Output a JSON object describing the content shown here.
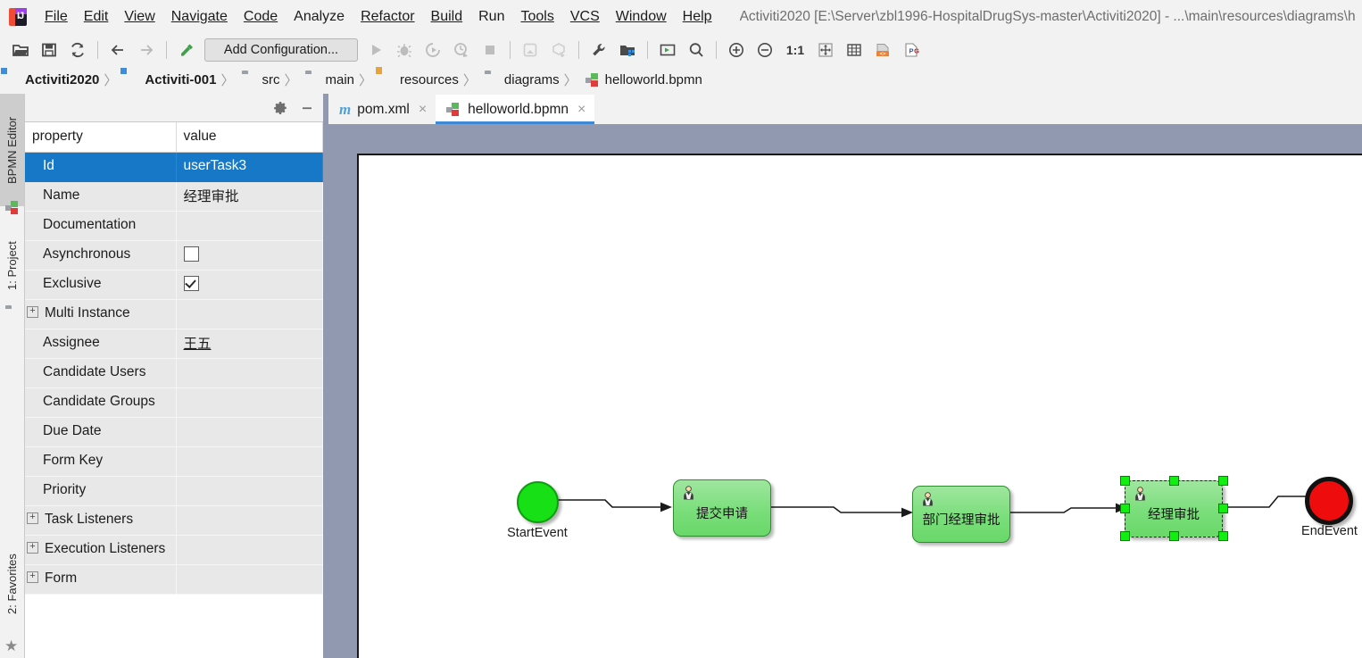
{
  "window": {
    "title": "Activiti2020 [E:\\Server\\zbl1996-HospitalDrugSys-master\\Activiti2020] - ...\\main\\resources\\diagrams\\h",
    "logo_letter": "IJ"
  },
  "menubar": {
    "items": [
      {
        "label": "File",
        "mnemonic": "F"
      },
      {
        "label": "Edit",
        "mnemonic": "E"
      },
      {
        "label": "View",
        "mnemonic": "V"
      },
      {
        "label": "Navigate",
        "mnemonic": "N"
      },
      {
        "label": "Code",
        "mnemonic": "C"
      },
      {
        "label": "Analyze",
        "mnemonic": "z"
      },
      {
        "label": "Refactor",
        "mnemonic": "R"
      },
      {
        "label": "Build",
        "mnemonic": "B"
      },
      {
        "label": "Run",
        "mnemonic": "u"
      },
      {
        "label": "Tools",
        "mnemonic": "T"
      },
      {
        "label": "VCS",
        "mnemonic": "S"
      },
      {
        "label": "Window",
        "mnemonic": "W"
      },
      {
        "label": "Help",
        "mnemonic": "H"
      }
    ]
  },
  "toolbar": {
    "add_configuration_label": "Add Configuration...",
    "zoom_reset_label": "1:1",
    "buttons": [
      {
        "name": "open-project-icon",
        "tooltip": "Open"
      },
      {
        "name": "save-all-icon",
        "tooltip": "Save All"
      },
      {
        "name": "sync-icon",
        "tooltip": "Synchronize"
      },
      {
        "name": "back-arrow-icon",
        "tooltip": "Back"
      },
      {
        "name": "forward-arrow-icon",
        "tooltip": "Forward"
      },
      {
        "name": "build-hammer-icon",
        "tooltip": "Build Project"
      },
      {
        "name": "run-icon",
        "tooltip": "Run"
      },
      {
        "name": "debug-icon",
        "tooltip": "Debug"
      },
      {
        "name": "run-coverage-icon",
        "tooltip": "Run with Coverage"
      },
      {
        "name": "profile-icon",
        "tooltip": "Profile"
      },
      {
        "name": "stop-icon",
        "tooltip": "Stop"
      },
      {
        "name": "update-project-icon",
        "tooltip": "Update Project"
      },
      {
        "name": "commit-icon",
        "tooltip": "Commit"
      },
      {
        "name": "settings-wrench-icon",
        "tooltip": "Settings"
      },
      {
        "name": "project-structure-icon",
        "tooltip": "Project Structure"
      },
      {
        "name": "preview-icon",
        "tooltip": "Preview"
      },
      {
        "name": "search-everywhere-icon",
        "tooltip": "Search Everywhere"
      },
      {
        "name": "zoom-in-icon",
        "tooltip": "Zoom In"
      },
      {
        "name": "zoom-out-icon",
        "tooltip": "Zoom Out"
      },
      {
        "name": "actual-size-icon",
        "tooltip": "Actual Size"
      },
      {
        "name": "fit-content-icon",
        "tooltip": "Fit Content"
      },
      {
        "name": "grid-icon",
        "tooltip": "Show Grid"
      },
      {
        "name": "export-source-icon",
        "tooltip": "Export to Source"
      },
      {
        "name": "export-png-icon",
        "tooltip": "Export to PNG"
      }
    ]
  },
  "breadcrumb": {
    "items": [
      {
        "label": "Activiti2020",
        "icon": "module-icon",
        "bold": true
      },
      {
        "label": "Activiti-001",
        "icon": "module-icon",
        "bold": true
      },
      {
        "label": "src",
        "icon": "folder-icon",
        "bold": false
      },
      {
        "label": "main",
        "icon": "folder-icon",
        "bold": false
      },
      {
        "label": "resources",
        "icon": "resources-folder-icon",
        "bold": false
      },
      {
        "label": "diagrams",
        "icon": "folder-icon",
        "bold": false
      },
      {
        "label": "helloworld.bpmn",
        "icon": "bpmn-file-icon",
        "bold": false
      }
    ],
    "separator": "〉"
  },
  "toolwindows": {
    "bpmn_editor": "BPMN Editor",
    "project": "1: Project",
    "favorites": "2: Favorites"
  },
  "property_panel": {
    "header": {
      "settings_icon": "gear-icon",
      "minimize_icon": "minimize-icon"
    },
    "columns": [
      "property",
      "value"
    ],
    "rows": [
      {
        "property": "Id",
        "value": "userTask3",
        "selected": true,
        "type": "text"
      },
      {
        "property": "Name",
        "value": "经理审批",
        "selected": false,
        "type": "text"
      },
      {
        "property": "Documentation",
        "value": "",
        "selected": false,
        "type": "text"
      },
      {
        "property": "Asynchronous",
        "value": "",
        "selected": false,
        "type": "checkbox",
        "checked": false
      },
      {
        "property": "Exclusive",
        "value": "",
        "selected": false,
        "type": "checkbox",
        "checked": true
      },
      {
        "property": "Multi Instance",
        "value": "",
        "selected": false,
        "type": "text",
        "expandable": true
      },
      {
        "property": "Assignee",
        "value": "王五",
        "selected": false,
        "type": "link"
      },
      {
        "property": "Candidate Users",
        "value": "",
        "selected": false,
        "type": "text"
      },
      {
        "property": "Candidate Groups",
        "value": "",
        "selected": false,
        "type": "text"
      },
      {
        "property": "Due Date",
        "value": "",
        "selected": false,
        "type": "text"
      },
      {
        "property": "Form Key",
        "value": "",
        "selected": false,
        "type": "text"
      },
      {
        "property": "Priority",
        "value": "",
        "selected": false,
        "type": "text"
      },
      {
        "property": "Task Listeners",
        "value": "",
        "selected": false,
        "type": "text",
        "expandable": true
      },
      {
        "property": "Execution Listeners",
        "value": "",
        "selected": false,
        "type": "text",
        "expandable": true
      },
      {
        "property": "Form",
        "value": "",
        "selected": false,
        "type": "text",
        "expandable": true
      }
    ],
    "expander_glyph": "+"
  },
  "editor_tabs": {
    "tabs": [
      {
        "label": "pom.xml",
        "icon": "maven-icon",
        "active": false,
        "close": "×"
      },
      {
        "label": "helloworld.bpmn",
        "icon": "bpmn-file-icon",
        "active": true,
        "close": "×"
      }
    ]
  },
  "diagram": {
    "accent_selection_color": "#12ee12",
    "task_fill_color": "#7ade7a",
    "start_event_color": "#17e017",
    "end_event_color": "#ef0c0c",
    "nodes": [
      {
        "id": "startEvent",
        "type": "start-event",
        "label": "StartEvent",
        "label_position": "below"
      },
      {
        "id": "userTask1",
        "type": "user-task",
        "label": "提交申请",
        "selected": false
      },
      {
        "id": "userTask2",
        "type": "user-task",
        "label": "部门经理审批",
        "selected": false
      },
      {
        "id": "userTask3",
        "type": "user-task",
        "label": "经理审批",
        "selected": true
      },
      {
        "id": "endEvent",
        "type": "end-event",
        "label": "EndEvent",
        "label_position": "below"
      }
    ]
  }
}
